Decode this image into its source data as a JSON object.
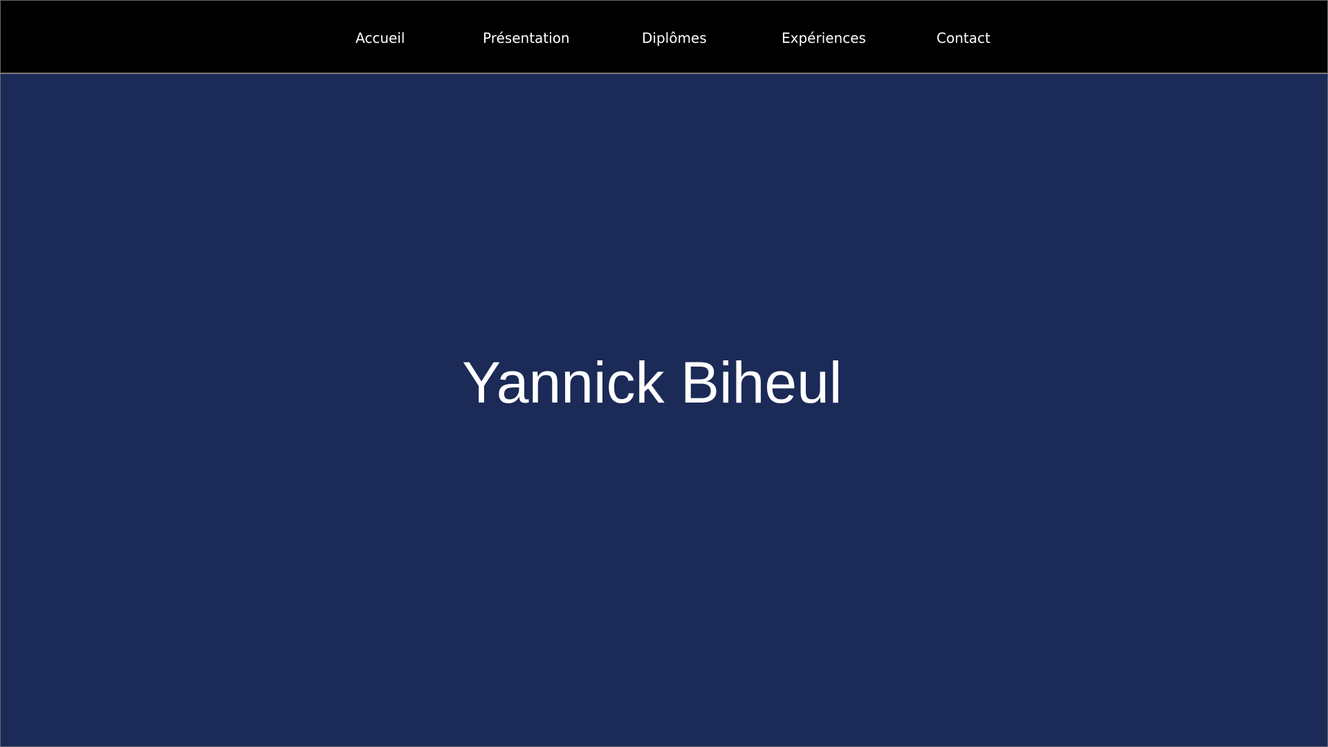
{
  "nav": {
    "items": [
      {
        "label": "Accueil"
      },
      {
        "label": "Présentation"
      },
      {
        "label": "Diplômes"
      },
      {
        "label": "Expériences"
      },
      {
        "label": "Contact"
      }
    ]
  },
  "hero": {
    "title": "Yannick Biheul"
  },
  "colors": {
    "nav_background": "#000000",
    "hero_background": "#1b2a57",
    "text": "#ffffff"
  }
}
